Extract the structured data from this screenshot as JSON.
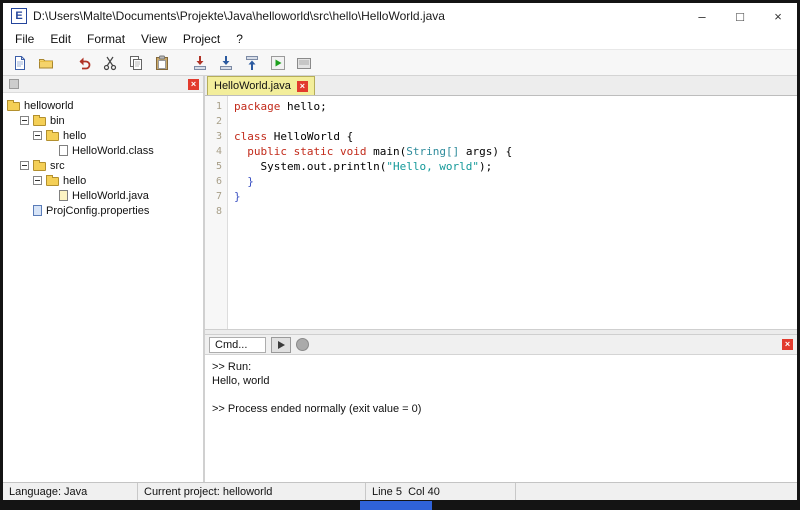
{
  "window": {
    "title": "D:\\Users\\Malte\\Documents\\Projekte\\Java\\helloworld\\src\\hello\\HelloWorld.java",
    "icon_letter": "E",
    "controls": {
      "minimize": "–",
      "maximize": "□",
      "close": "×"
    }
  },
  "menu": {
    "items": [
      "File",
      "Edit",
      "Format",
      "View",
      "Project",
      "?"
    ]
  },
  "toolbar": {
    "buttons": [
      {
        "name": "new-file-button",
        "icon": "new-file-icon"
      },
      {
        "name": "open-file-button",
        "icon": "open-folder-icon"
      },
      {
        "name": "undo-button",
        "icon": "undo-icon",
        "gap": true
      },
      {
        "name": "cut-button",
        "icon": "cut-icon"
      },
      {
        "name": "copy-button",
        "icon": "copy-icon"
      },
      {
        "name": "paste-button",
        "icon": "paste-icon"
      },
      {
        "name": "compile-button",
        "icon": "compile-icon",
        "gap": true
      },
      {
        "name": "compile-all-button",
        "icon": "compile-all-icon"
      },
      {
        "name": "build-jar-button",
        "icon": "jar-icon"
      },
      {
        "name": "run-button",
        "icon": "run-icon"
      },
      {
        "name": "terminal-button",
        "icon": "terminal-icon"
      }
    ]
  },
  "tree": {
    "items": [
      {
        "label": "helloworld",
        "icon": "folder",
        "level": 0,
        "expander": false
      },
      {
        "label": "bin",
        "icon": "folder",
        "level": 1,
        "expander": true
      },
      {
        "label": "hello",
        "icon": "folder",
        "level": 2,
        "expander": true
      },
      {
        "label": "HelloWorld.class",
        "icon": "file-class",
        "level": 3,
        "expander": false
      },
      {
        "label": "src",
        "icon": "folder",
        "level": 1,
        "expander": true
      },
      {
        "label": "hello",
        "icon": "folder",
        "level": 2,
        "expander": true
      },
      {
        "label": "HelloWorld.java",
        "icon": "file-java",
        "level": 3,
        "expander": false
      },
      {
        "label": "ProjConfig.properties",
        "icon": "file-properties",
        "level": 1,
        "expander": false
      }
    ]
  },
  "editor": {
    "tab_label": "HelloWorld.java",
    "lines": [
      {
        "n": "1",
        "seg": [
          [
            "k",
            "package"
          ],
          [
            "p",
            " hello;"
          ]
        ]
      },
      {
        "n": "2",
        "seg": []
      },
      {
        "n": "3",
        "seg": [
          [
            "k",
            "class"
          ],
          [
            "p",
            " HelloWorld {"
          ]
        ]
      },
      {
        "n": "4",
        "seg": [
          [
            "p",
            "  "
          ],
          [
            "k",
            "public"
          ],
          [
            "p",
            " "
          ],
          [
            "k",
            "static"
          ],
          [
            "p",
            " "
          ],
          [
            "k",
            "void"
          ],
          [
            "p",
            " main("
          ],
          [
            "t",
            "String[]"
          ],
          [
            "p",
            " args) {"
          ]
        ]
      },
      {
        "n": "5",
        "seg": [
          [
            "p",
            "    System.out.println("
          ],
          [
            "s",
            "\"Hello, world\""
          ],
          [
            "p",
            ");"
          ]
        ]
      },
      {
        "n": "6",
        "seg": [
          [
            "b",
            "  }"
          ]
        ]
      },
      {
        "n": "7",
        "seg": [
          [
            "b",
            "}"
          ]
        ]
      },
      {
        "n": "8",
        "seg": []
      }
    ]
  },
  "output": {
    "header_label": "Cmd...",
    "lines": [
      ">> Run:",
      "Hello, world",
      "",
      ">> Process ended normally (exit value = 0)"
    ]
  },
  "statusbar": {
    "language": "Language: Java",
    "project": "Current project: helloworld",
    "position": "Line 5  Col 40"
  },
  "colors": {
    "keyword": "#C22A1A",
    "type": "#2E8B9B",
    "string": "#139999",
    "brace": "#3A50C2",
    "tab_active": "#F3EE9B",
    "close_red": "#E23B2E",
    "run_green": "#1DA01D",
    "taskbar_blue": "#2F62D8"
  }
}
